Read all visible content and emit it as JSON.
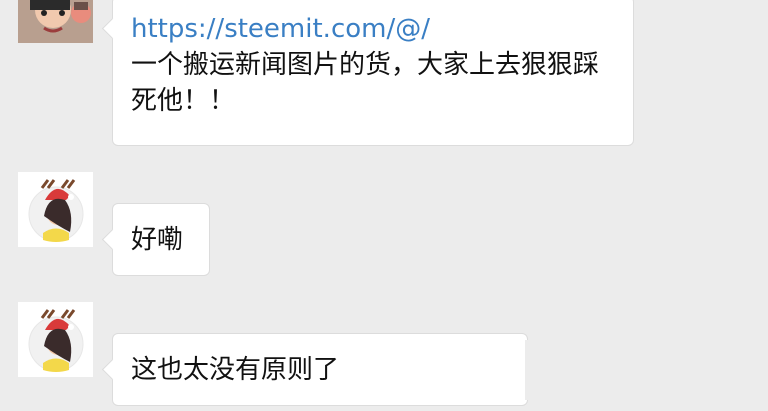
{
  "messages": [
    {
      "link": "https://steemit.com/@/",
      "text": "一个搬运新闻图片的货，大家上去狠狠踩死他！！"
    },
    {
      "text": "好嘞"
    },
    {
      "text": "这也太没有原则了"
    }
  ],
  "colors": {
    "background": "#ececec",
    "bubble": "#ffffff",
    "link": "#3a7fc4",
    "avatar_skin": "#f3c6a5",
    "avatar_hat": "#d93a3a",
    "avatar_shirt": "#f3d84a"
  },
  "icons": {
    "avatar_1": "user-photo-icon",
    "avatar_2": "reindeer-girl-avatar-icon",
    "avatar_3": "reindeer-girl-avatar-icon"
  }
}
